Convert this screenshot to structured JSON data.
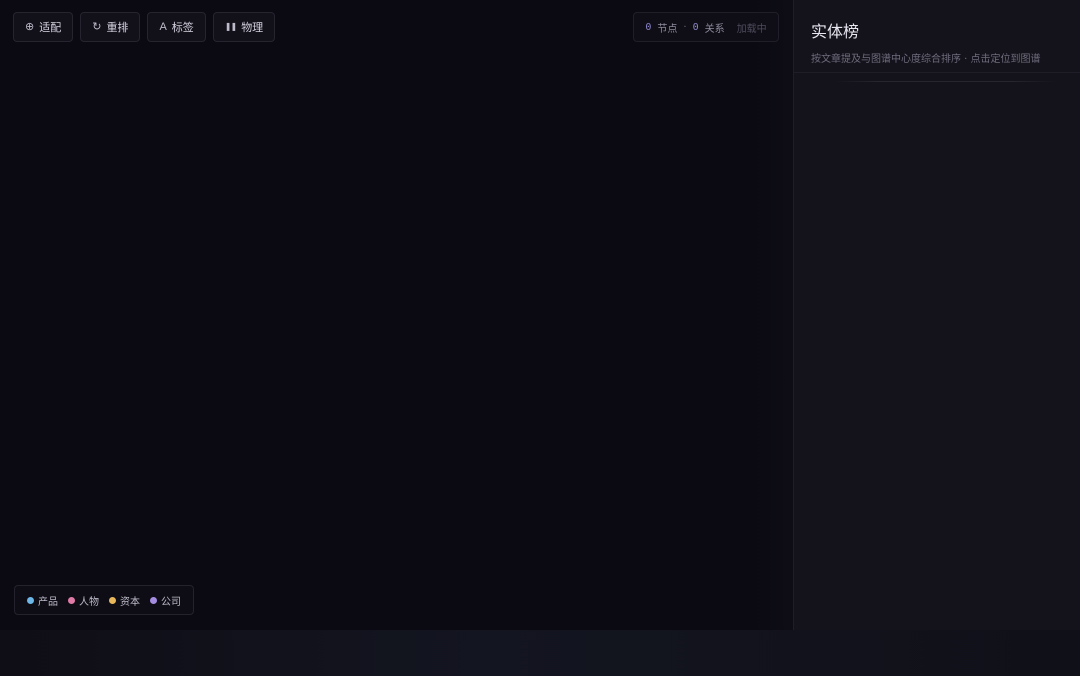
{
  "toolbar": {
    "buttons": [
      {
        "icon": "crosshair-icon",
        "glyph": "⊕",
        "label": "适配"
      },
      {
        "icon": "refresh-icon",
        "glyph": "↻",
        "label": "重排"
      },
      {
        "icon": "label-icon",
        "glyph": "A",
        "label": "标签"
      },
      {
        "icon": "pause-icon",
        "glyph": "❚❚",
        "label": "物理"
      }
    ]
  },
  "stats": {
    "node_count": "0",
    "node_label": "节点",
    "separator": "·",
    "edge_count": "0",
    "edge_label": "关系",
    "status": "加载中"
  },
  "legend": {
    "items": [
      {
        "label": "产品",
        "color": "#6cb6e8"
      },
      {
        "label": "人物",
        "color": "#e07aa6"
      },
      {
        "label": "资本",
        "color": "#e8b75c"
      },
      {
        "label": "公司",
        "color": "#a48de0"
      }
    ]
  },
  "panel": {
    "title": "实体榜",
    "subtitle": "按文章提及与图谱中心度综合排序 · 点击定位到图谱"
  }
}
